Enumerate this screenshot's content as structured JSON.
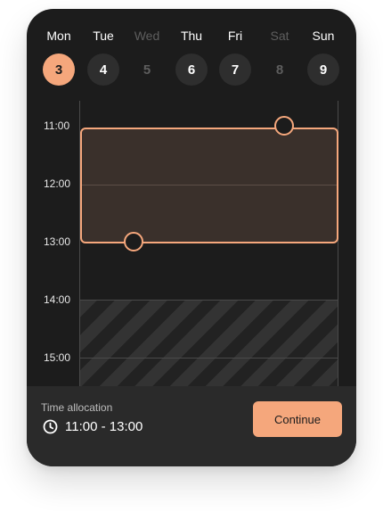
{
  "colors": {
    "accent": "#f5a77c",
    "card_background": "#1c1c1c",
    "footer_background": "#2a2a2a",
    "muted_text": "#5e5e5e"
  },
  "week": {
    "days": [
      {
        "name": "Mon",
        "number": "3",
        "state": "selected"
      },
      {
        "name": "Tue",
        "number": "4",
        "state": "available"
      },
      {
        "name": "Wed",
        "number": "5",
        "state": "disabled"
      },
      {
        "name": "Thu",
        "number": "6",
        "state": "available"
      },
      {
        "name": "Fri",
        "number": "7",
        "state": "available"
      },
      {
        "name": "Sat",
        "number": "8",
        "state": "disabled"
      },
      {
        "name": "Sun",
        "number": "9",
        "state": "available"
      }
    ]
  },
  "timeline": {
    "hours": [
      "11:00",
      "12:00",
      "13:00",
      "14:00",
      "15:00"
    ],
    "selection": {
      "start": "11:00",
      "end": "13:00"
    },
    "unavailable_from": "14:00"
  },
  "footer": {
    "label": "Time allocation",
    "icon": "clock-icon",
    "value": "11:00 - 13:00",
    "button_label": "Continue"
  }
}
